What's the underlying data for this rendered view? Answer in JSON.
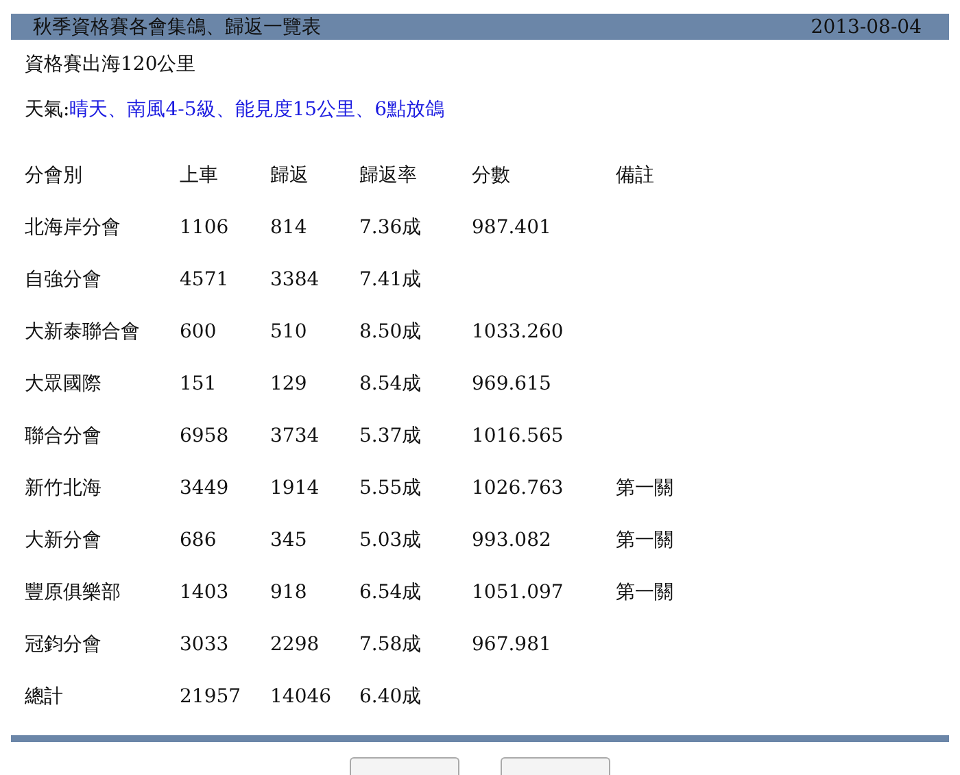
{
  "header": {
    "title": "秋季資格賽各會集鴿、歸返一覽表",
    "date": "2013-08-04"
  },
  "subtitle": "資格賽出海120公里",
  "weather": {
    "label": "天氣:",
    "value": "晴天、南風4-5級、能見度15公里、6點放鴿"
  },
  "table": {
    "columns": [
      "分會別",
      "上車",
      "歸返",
      "歸返率",
      "分數",
      "備註"
    ],
    "rows": [
      [
        "北海岸分會",
        "1106",
        "814",
        "7.36成",
        "987.401",
        ""
      ],
      [
        "自強分會",
        "4571",
        "3384",
        "7.41成",
        "",
        ""
      ],
      [
        "大新泰聯合會",
        "600",
        "510",
        "8.50成",
        "1033.260",
        ""
      ],
      [
        "大眾國際",
        "151",
        "129",
        "8.54成",
        "969.615",
        ""
      ],
      [
        "聯合分會",
        "6958",
        "3734",
        "5.37成",
        "1016.565",
        ""
      ],
      [
        "新竹北海",
        "3449",
        "1914",
        "5.55成",
        "1026.763",
        "第一關"
      ],
      [
        "大新分會",
        "686",
        "345",
        "5.03成",
        "993.082",
        "第一關"
      ],
      [
        "豐原俱樂部",
        "1403",
        "918",
        "6.54成",
        "1051.097",
        "第一關"
      ],
      [
        "冠鈞分會",
        "3033",
        "2298",
        "7.58成",
        "967.981",
        ""
      ],
      [
        "總計",
        "21957",
        "14046",
        "6.40成",
        "",
        ""
      ]
    ]
  },
  "footer_buttons": [
    {
      "kind": "button"
    },
    {
      "kind": "button"
    }
  ]
}
